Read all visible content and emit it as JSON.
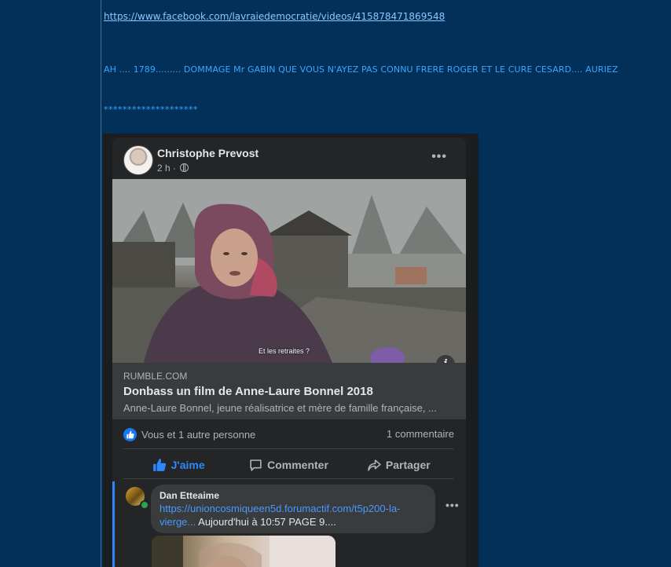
{
  "post": {
    "video_link": "https://www.facebook.com/lavraiedemocratie/videos/415878471869548",
    "message": "AH .... 1789.........  DOMMAGE Mr GABIN QUE VOUS N'AYEZ PAS CONNU FRERE ROGER ET LE CURE CESARD.... AURIEZ",
    "separator": "********************"
  },
  "facebook_embed": {
    "author": "Christophe Prevost",
    "time": "2 h ·",
    "video_subtitle": "Et les retraites ?",
    "link_preview": {
      "domain": "RUMBLE.COM",
      "title": "Donbass un film de Anne-Laure Bonnel 2018",
      "description": "Anne-Laure Bonnel, jeune réalisatrice et mère de famille française, ..."
    },
    "reactions_text": "Vous et 1 autre personne",
    "comments_count": "1 commentaire",
    "actions": {
      "like": "J'aime",
      "comment": "Commenter",
      "share": "Partager"
    },
    "comment": {
      "author": "Dan Etteaime",
      "link_text": "https://unioncosmiqueen5d.forumactif.com/t5p200-la-vierge...",
      "text": " Aujourd'hui à 10:57 PAGE 9...."
    },
    "icons": [
      "globe-icon",
      "more-icon",
      "info-icon",
      "like-icon",
      "comment-icon",
      "share-icon"
    ],
    "colors": {
      "accent": "#2d88ff",
      "card_bg": "#242526",
      "page_bg": "#023059",
      "text_link": "#39a7ff"
    }
  }
}
